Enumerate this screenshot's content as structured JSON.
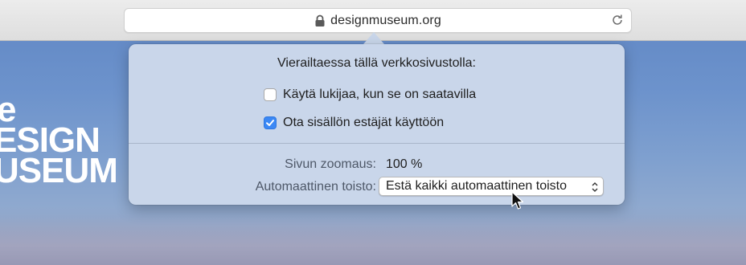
{
  "browser": {
    "url": "designmuseum.org"
  },
  "site": {
    "logo_lines": [
      "e",
      "ESIGN",
      "USEUM"
    ]
  },
  "popover": {
    "heading": "Vierailtaessa tällä verkkosivustolla:",
    "checkboxes": [
      {
        "label": "Käytä lukijaa, kun se on saatavilla",
        "checked": false
      },
      {
        "label": "Ota sisällön estäjät käyttöön",
        "checked": true
      }
    ],
    "zoom": {
      "label": "Sivun zoomaus:",
      "value": "100 %"
    },
    "autoplay": {
      "label": "Automaattinen toisto:",
      "selected": "Estä kaikki automaattinen toisto"
    }
  },
  "colors": {
    "accent": "#3b88f5",
    "popover_bg": "#c9d6ea"
  }
}
